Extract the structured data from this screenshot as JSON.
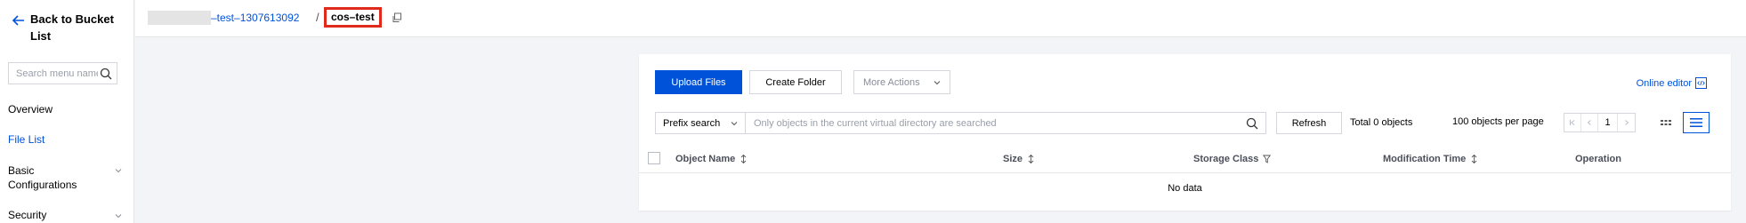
{
  "sidebar": {
    "back_label": "Back to Bucket List",
    "search_placeholder": "Search menu name",
    "items": [
      {
        "label": "Overview"
      },
      {
        "label": "File List"
      },
      {
        "label": "Basic Configurations"
      },
      {
        "label": "Security"
      }
    ]
  },
  "breadcrumb": {
    "bucket_label": "–test–1307613092",
    "separator": "/",
    "current": "cos–test"
  },
  "toolbar": {
    "upload_label": "Upload Files",
    "create_folder_label": "Create Folder",
    "more_actions_label": "More Actions",
    "online_editor_label": "Online editor"
  },
  "filter": {
    "prefix_label": "Prefix search",
    "search_placeholder": "Only objects in the current virtual directory are searched",
    "refresh_label": "Refresh",
    "total_label": "Total 0 objects",
    "per_page_label": "100 objects per page",
    "page_number": "1"
  },
  "table": {
    "columns": [
      "Object Name",
      "Size",
      "Storage Class",
      "Modification Time",
      "Operation"
    ],
    "empty_text": "No data"
  },
  "colors": {
    "accent": "#0052d9",
    "highlight_border": "#e02a1b"
  }
}
